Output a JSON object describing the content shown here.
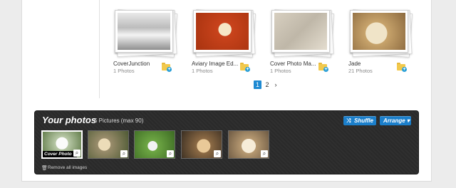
{
  "albums": [
    {
      "name": "CoverJunction",
      "count": "1 Photos"
    },
    {
      "name": "Aviary Image Ed...",
      "count": "1 Photos"
    },
    {
      "name": "Cover Photo Ma...",
      "count": "1 Photos"
    },
    {
      "name": "Jade",
      "count": "21 Photos"
    }
  ],
  "pagination": {
    "current": "1",
    "next_page": "2",
    "next_icon": "›"
  },
  "your_photos": {
    "title": "Your photos",
    "subtitle": "5 Pictures (max 90)",
    "shuffle_label": "Shuffle",
    "shuffle_icon": "⤨",
    "arrange_label": "Arrange ▾",
    "cover_label": "Cover Photo",
    "remove_all": "Remove all images",
    "remove_icon": "🗑",
    "magnify_icon": "⌕"
  },
  "colors": {
    "accent": "#1f8ad2",
    "dark_panel": "#2b2b2b"
  }
}
